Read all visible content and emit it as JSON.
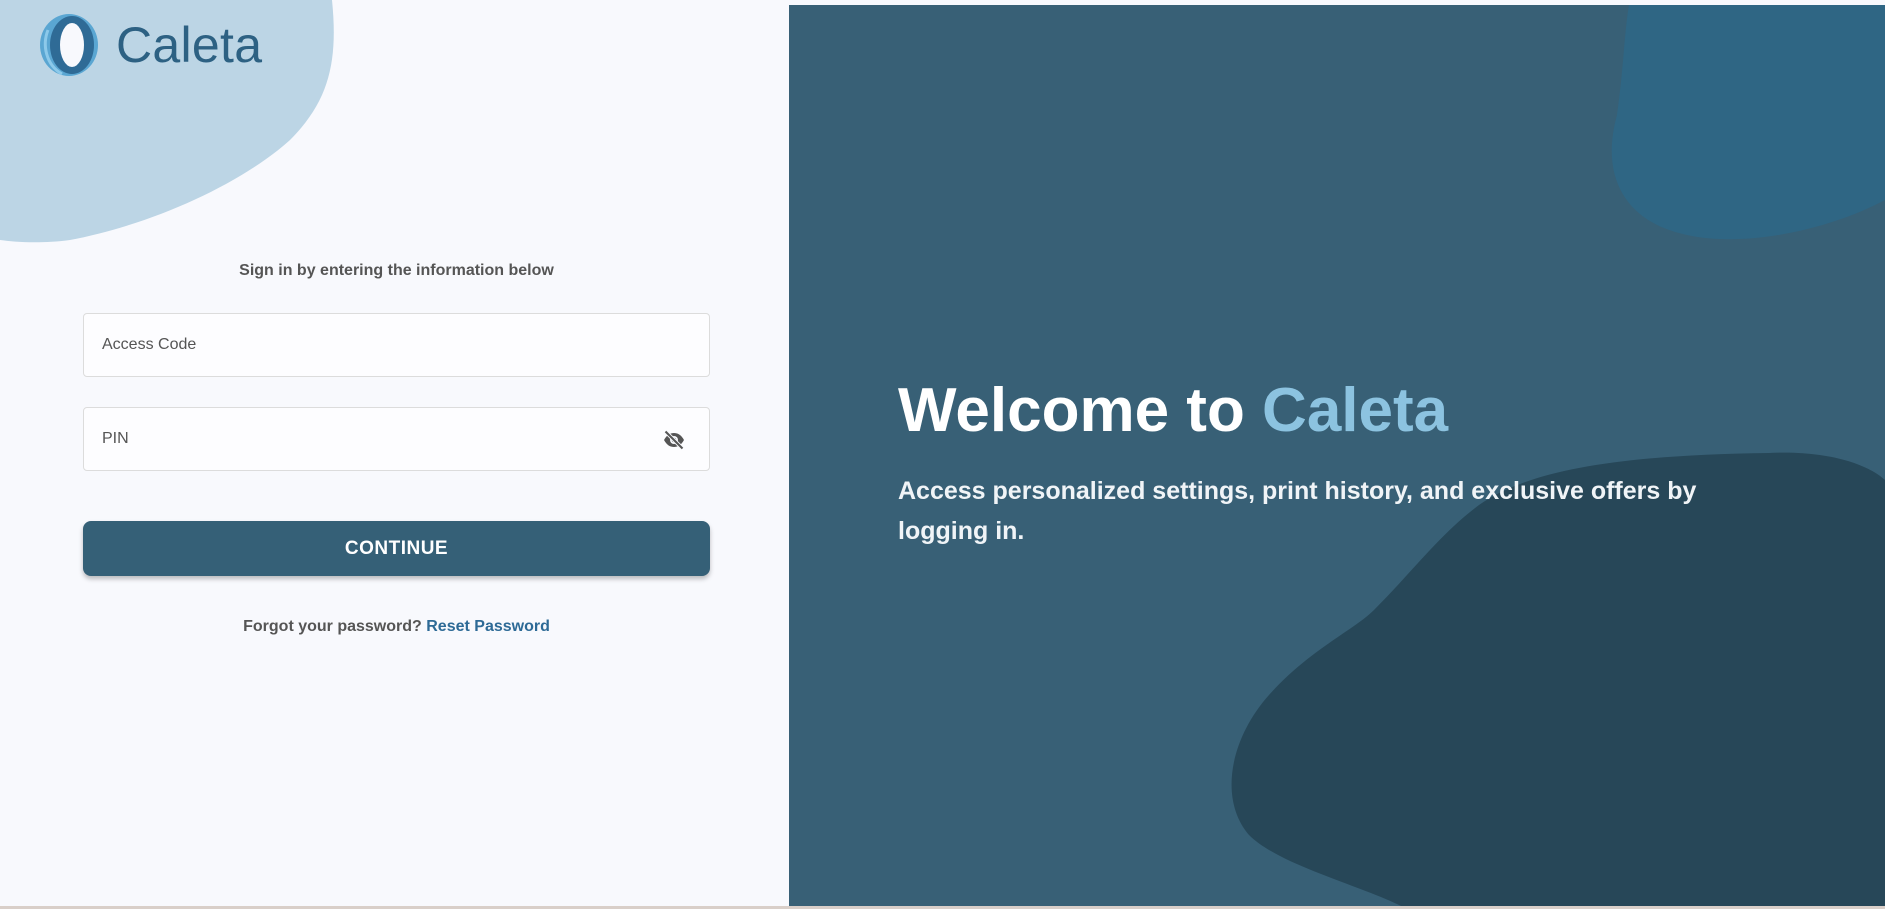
{
  "brand": {
    "name": "Caleta",
    "logo_icon": "ring-logo-icon",
    "color": "#2d6183"
  },
  "signin": {
    "subtitle": "Sign in by entering the information below",
    "access_code_placeholder": "Access Code",
    "pin_placeholder": "PIN",
    "pin_visibility_icon": "eye-off-icon",
    "continue_label": "CONTINUE",
    "forgot_text": "Forgot your password?",
    "reset_link": "Reset Password"
  },
  "hero": {
    "welcome_prefix": "Welcome to ",
    "welcome_brand": "Caleta",
    "description": "Access personalized settings, print history, and exclusive offers by logging in."
  },
  "colors": {
    "primary": "#356077",
    "right_panel": "#386076",
    "accent_light": "#8cc3e0",
    "link": "#2d6a96",
    "blob_light": "#bcd5e5"
  }
}
